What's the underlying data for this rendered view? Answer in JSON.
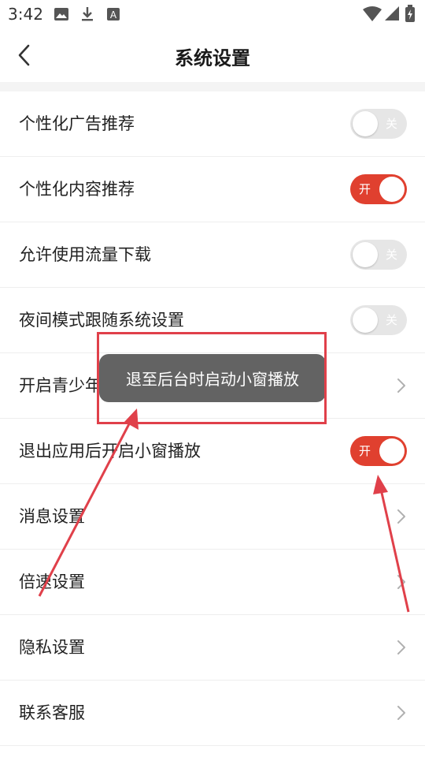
{
  "status_bar": {
    "time": "3:42",
    "left_icons": [
      "image-icon",
      "download-icon",
      "text-app-icon"
    ],
    "right_icons": [
      "wifi-icon",
      "signal-icon",
      "battery-icon"
    ]
  },
  "header": {
    "title": "系统设置",
    "back_icon": "chevron-left-icon"
  },
  "settings": {
    "items": [
      {
        "label": "个性化广告推荐",
        "control": "toggle",
        "state": "off",
        "state_label": "关"
      },
      {
        "label": "个性化内容推荐",
        "control": "toggle",
        "state": "on",
        "state_label": "开"
      },
      {
        "label": "允许使用流量下载",
        "control": "toggle",
        "state": "off",
        "state_label": "关"
      },
      {
        "label": "夜间模式跟随系统设置",
        "control": "toggle",
        "state": "off",
        "state_label": "关"
      },
      {
        "label": "开启青少年模式",
        "control": "chevron"
      },
      {
        "label": "退出应用后开启小窗播放",
        "control": "toggle",
        "state": "on",
        "state_label": "开"
      },
      {
        "label": "消息设置",
        "control": "chevron"
      },
      {
        "label": "倍速设置",
        "control": "chevron"
      },
      {
        "label": "隐私设置",
        "control": "chevron"
      },
      {
        "label": "联系客服",
        "control": "chevron"
      }
    ]
  },
  "toast": {
    "text": "退至后台时启动小窗播放"
  },
  "colors": {
    "accent": "#e0402f",
    "toggle_off": "#e6e6e6",
    "toast_bg": "#636363",
    "annotation": "#e0404a"
  }
}
